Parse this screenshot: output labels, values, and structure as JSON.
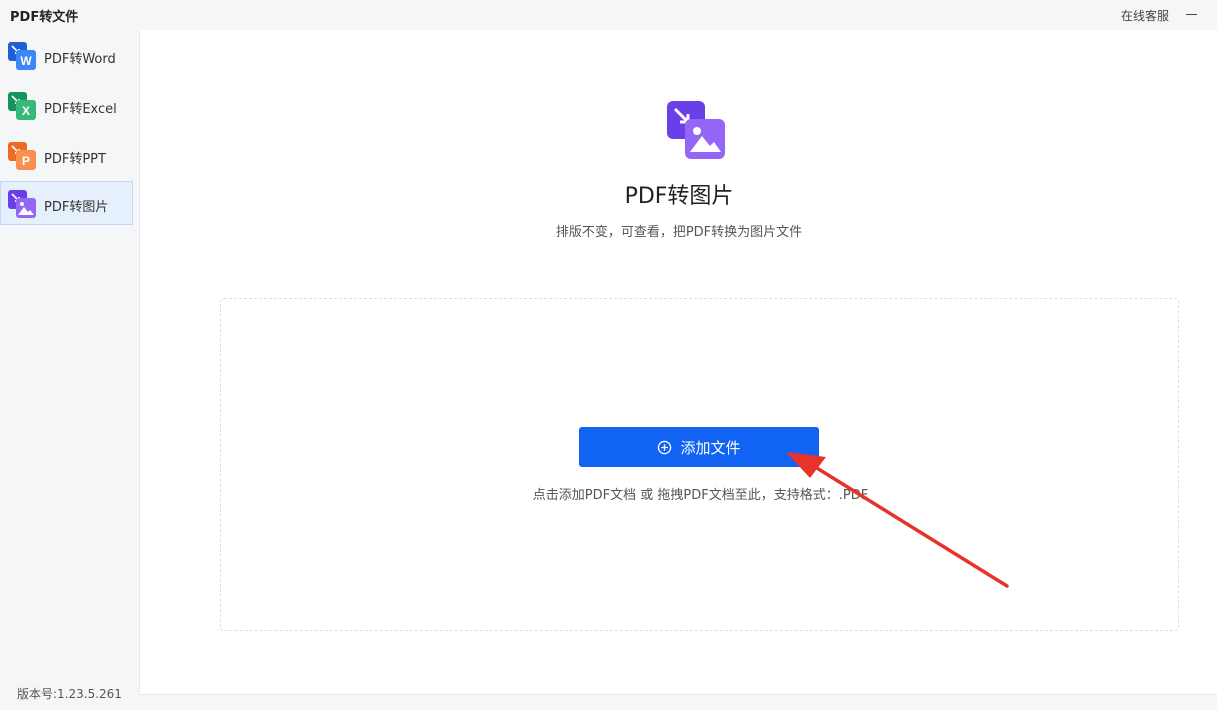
{
  "titlebar": {
    "app_title": "PDF转文件",
    "support_label": "在线客服"
  },
  "sidebar": {
    "items": [
      {
        "label": "PDF转Word",
        "icon": "word-doc-icon",
        "color": "#2b6fe8",
        "letter": "W"
      },
      {
        "label": "PDF转Excel",
        "icon": "excel-doc-icon",
        "color": "#21a366",
        "letter": "X"
      },
      {
        "label": "PDF转PPT",
        "icon": "ppt-doc-icon",
        "color": "#f27a3a",
        "letter": "P"
      },
      {
        "label": "PDF转图片",
        "icon": "image-doc-icon",
        "color": "#7c4df0",
        "letter": ""
      }
    ],
    "active_index": 3,
    "version": "版本号:1.23.5.261"
  },
  "main": {
    "title": "PDF转图片",
    "subtitle": "排版不变，可查看，把PDF转换为图片文件",
    "add_button_label": "添加文件",
    "drop_hint": "点击添加PDF文档 或 拖拽PDF文档至此，支持格式：.PDF",
    "accent_color": "#1063f3",
    "annotation_arrow_color": "#e8322b"
  }
}
